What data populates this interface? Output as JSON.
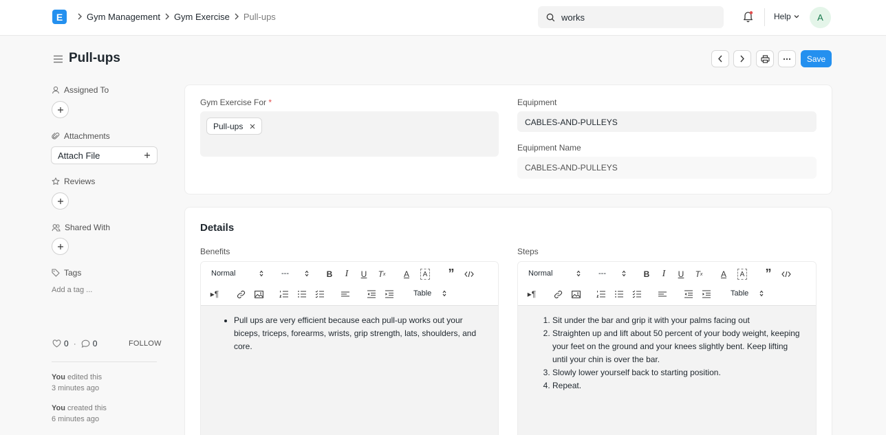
{
  "navbar": {
    "logo_letter": "E",
    "breadcrumbs": [
      "Gym Management",
      "Gym Exercise",
      "Pull-ups"
    ],
    "search_value": "works",
    "help_label": "Help",
    "avatar_initial": "A"
  },
  "page": {
    "title": "Pull-ups",
    "save_label": "Save"
  },
  "sidebar": {
    "assigned_to": "Assigned To",
    "attachments": "Attachments",
    "attach_file": "Attach File",
    "reviews": "Reviews",
    "shared_with": "Shared With",
    "tags": "Tags",
    "add_tag": "Add a tag ...",
    "likes": "0",
    "comments": "0",
    "follow": "FOLLOW",
    "activity": [
      {
        "who": "You",
        "action": " edited this",
        "when": "3 minutes ago"
      },
      {
        "who": "You",
        "action": " created this",
        "when": "6 minutes ago"
      }
    ]
  },
  "form": {
    "gym_exercise_for_label": "Gym Exercise For",
    "required_mark": "*",
    "gym_exercise_for_value": "Pull-ups",
    "equipment_label": "Equipment",
    "equipment_value": "CABLES-AND-PULLEYS",
    "equipment_name_label": "Equipment Name",
    "equipment_name_value": "CABLES-AND-PULLEYS"
  },
  "details": {
    "title": "Details",
    "benefits_label": "Benefits",
    "steps_label": "Steps",
    "toolbar": {
      "style_select": "Normal",
      "size_select": "---",
      "table_select": "Table"
    },
    "benefits_items": [
      "Pull ups are very efficient because each pull-up works out your biceps, triceps, forearms, wrists, grip strength, lats, shoulders, and core."
    ],
    "steps_items": [
      "Sit under the bar and grip it with your palms facing out",
      "Straighten up and lift about 50 percent of your body weight, keeping your feet on the ground and your knees slightly bent. Keep lifting until your chin is over the bar.",
      "Slowly lower yourself back to starting position.",
      "Repeat."
    ]
  },
  "colors": {
    "primary": "#2490ef",
    "required": "#e24c4c",
    "avatar_bg": "#e4f5e9",
    "avatar_fg": "#16794c"
  }
}
